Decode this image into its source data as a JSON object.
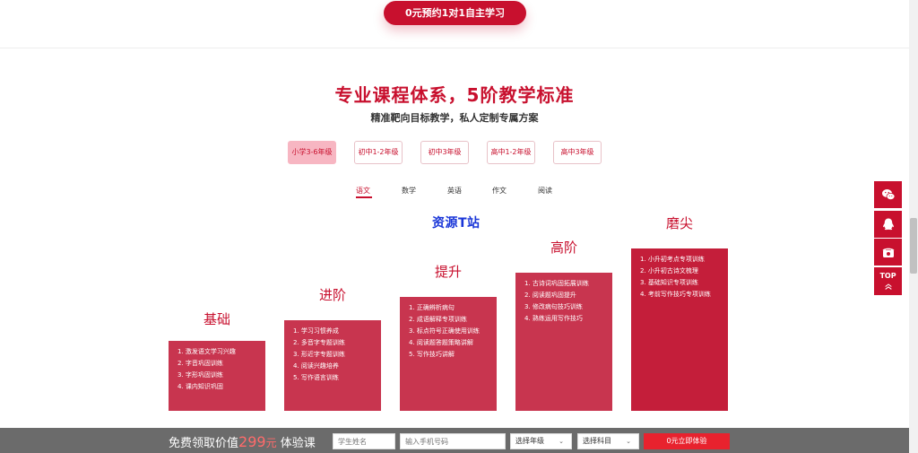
{
  "top_cta": "0元预约1对1自主学习",
  "section": {
    "title": "专业课程体系，5阶教学标准",
    "subtitle": "精准靶向目标教学，私人定制专属方案"
  },
  "grade_tabs": [
    "小学3-6年级",
    "初中1-2年级",
    "初中3年级",
    "高中1-2年级",
    "高中3年级"
  ],
  "subject_tabs": [
    "语文",
    "数学",
    "英语",
    "作文",
    "阅读"
  ],
  "watermark": "资源T站",
  "stages": [
    {
      "label": "基础",
      "items": [
        "1. 激发语文学习兴趣",
        "2. 字音巩固训练",
        "3. 字形巩固训练",
        "4. 课内知识巩固"
      ]
    },
    {
      "label": "进阶",
      "items": [
        "1. 学习习惯养成",
        "2. 多音字专题训练",
        "3. 形近字专题训练",
        "4. 阅读兴趣培养",
        "5. 写作语言训练"
      ]
    },
    {
      "label": "提升",
      "items": [
        "1. 正确辨析病句",
        "2. 成语解释专项训练",
        "3. 标点符号正确使用训练",
        "4. 阅读题答题策略讲解",
        "5. 写作技巧讲解"
      ]
    },
    {
      "label": "高阶",
      "items": [
        "1. 古诗词巩固拓展训练",
        "2. 阅读题巩固提升",
        "3. 修改病句技巧训练",
        "4. 熟练运用写作技巧"
      ]
    },
    {
      "label": "磨尖",
      "items": [
        "1. 小升初考点专项训练",
        "2. 小升初古诗文梳理",
        "3. 基础知识专项训练",
        "4. 考前写作技巧专项训练"
      ]
    }
  ],
  "side": {
    "wechat_icon": "wechat-icon",
    "qq_icon": "qq-icon",
    "phone_icon": "phone-icon",
    "top_label": "TOP"
  },
  "bottom_bar": {
    "prefix": "免费领取价值",
    "price": "299",
    "unit": "元",
    "suffix": "体验课",
    "name_placeholder": "学生姓名",
    "phone_placeholder": "输入手机号码",
    "grade_select": "选择年级",
    "subject_select": "选择科目",
    "submit": "0元立即体验"
  },
  "colors": {
    "accent": "#c8102e",
    "watermark": "#1a36d8",
    "bar": "#6b6b6b"
  }
}
